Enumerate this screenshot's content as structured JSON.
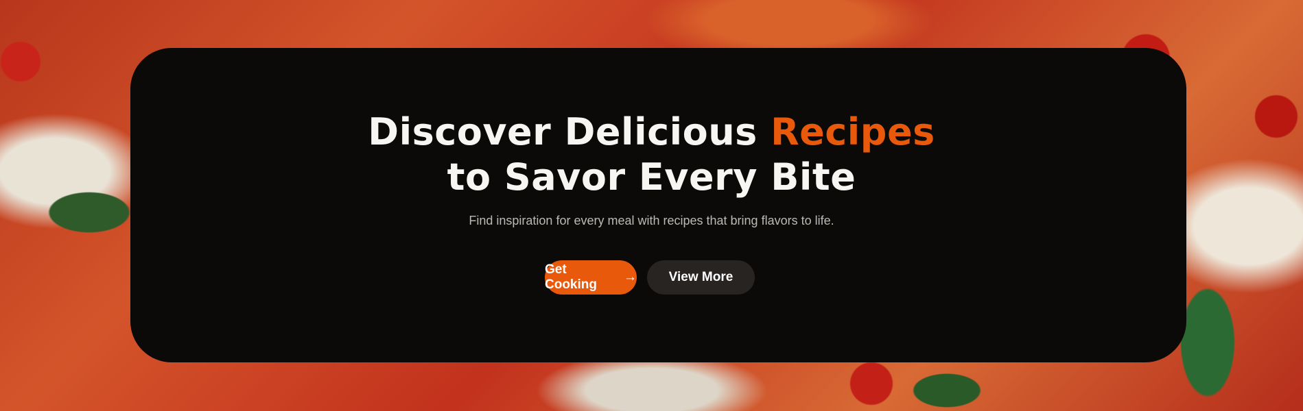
{
  "hero": {
    "title_part1": "Discover Delicious ",
    "title_accent": "Recipes",
    "title_line2": "to Savor Every Bite",
    "subtitle": "Find inspiration for every meal with recipes that bring flavors to life.",
    "primary_button": "Get Cooking",
    "primary_button_icon": "→",
    "secondary_button": "View More",
    "accent_color": "#e8590c"
  }
}
